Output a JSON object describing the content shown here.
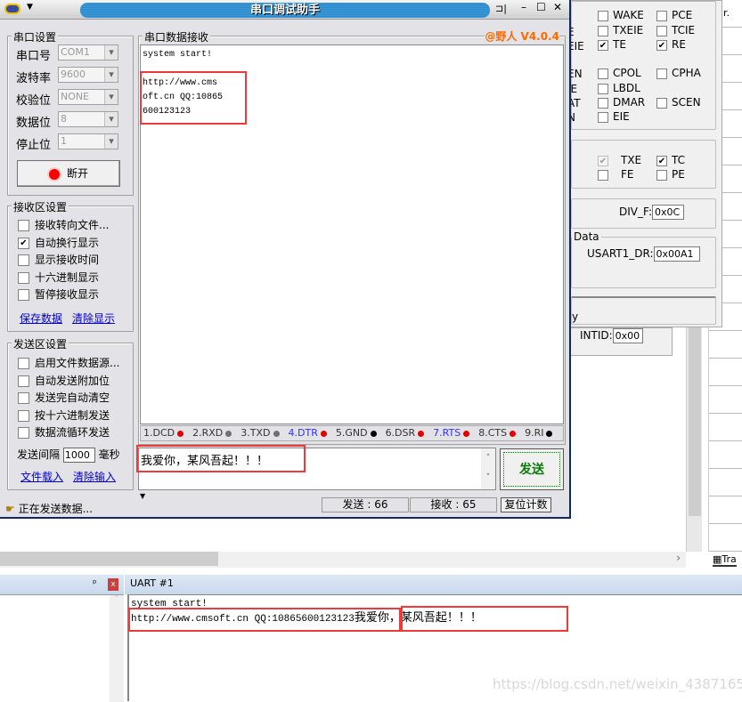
{
  "colors": {
    "title_blue": "#3a9ad9",
    "accent_orange": "#ff6a00",
    "send_green": "#0a7a0a",
    "highlight_red": "#f03a3a",
    "link_blue": "#0000cc"
  },
  "window": {
    "title": "串口调试助手",
    "version": "@野人 V4.0.4"
  },
  "port_settings": {
    "title": "串口设置",
    "fields": [
      {
        "label": "串口号",
        "value": "COM1"
      },
      {
        "label": "波特率",
        "value": "9600"
      },
      {
        "label": "校验位",
        "value": "NONE"
      },
      {
        "label": "数据位",
        "value": "8"
      },
      {
        "label": "停止位",
        "value": "1"
      }
    ],
    "open_button": "断开"
  },
  "recv_settings": {
    "title": "接收区设置",
    "options": [
      {
        "label": "接收转向文件...",
        "checked": false
      },
      {
        "label": "自动换行显示",
        "checked": true
      },
      {
        "label": "显示接收时间",
        "checked": false
      },
      {
        "label": "十六进制显示",
        "checked": false
      },
      {
        "label": "暂停接收显示",
        "checked": false
      }
    ],
    "save": "保存数据",
    "clear": "清除显示"
  },
  "send_settings": {
    "title": "发送区设置",
    "options": [
      {
        "label": "启用文件数据源...",
        "checked": false
      },
      {
        "label": "自动发送附加位",
        "checked": false
      },
      {
        "label": "发送完自动清空",
        "checked": false
      },
      {
        "label": "按十六进制发送",
        "checked": false
      },
      {
        "label": "数据流循环发送",
        "checked": false
      }
    ],
    "interval_label": "发送间隔",
    "interval_value": "1000",
    "interval_unit": "毫秒",
    "load": "文件载入",
    "clear": "清除输入"
  },
  "receive": {
    "title": "串口数据接收",
    "lines": [
      "system start!",
      "",
      "http://www.cms",
      "oft.cn QQ:10865",
      "600123123"
    ]
  },
  "pins": [
    {
      "label": "1.DCD",
      "color": "#e00000",
      "blue": false
    },
    {
      "label": "2.RXD",
      "color": "#707070",
      "blue": false
    },
    {
      "label": "3.TXD",
      "color": "#707070",
      "blue": false
    },
    {
      "label": "4.DTR",
      "color": "#e00000",
      "blue": true
    },
    {
      "label": "5.GND",
      "color": "#000000",
      "blue": false
    },
    {
      "label": "6.DSR",
      "color": "#e00000",
      "blue": false
    },
    {
      "label": "7.RTS",
      "color": "#e00000",
      "blue": true
    },
    {
      "label": "8.CTS",
      "color": "#e00000",
      "blue": false
    },
    {
      "label": "9.RI",
      "color": "#000000",
      "blue": false
    }
  ],
  "send": {
    "text": "我爱你，某风吾起！！！",
    "button": "发送"
  },
  "status": {
    "message": "正在发送数据...",
    "sent": "发送 : 66",
    "received": "接收 : 65",
    "reset": "复位计数"
  },
  "usart_panel": {
    "checks": [
      {
        "label": "WAKE",
        "checked": false
      },
      {
        "label": "PCE",
        "checked": false
      },
      {
        "label": "TXEIE",
        "checked": false
      },
      {
        "label": "TCIE",
        "checked": false
      },
      {
        "label": "TE",
        "checked": true
      },
      {
        "label": "RE",
        "checked": true
      },
      {
        "label": "CPOL",
        "checked": false
      },
      {
        "label": "CPHA",
        "checked": false
      },
      {
        "label": "LBDL",
        "checked": false
      },
      {
        "label": "DMAR",
        "checked": false
      },
      {
        "label": "SCEN",
        "checked": false
      },
      {
        "label": "EIE",
        "checked": false
      }
    ],
    "cut_labels": [
      "E",
      "EIE",
      "EN",
      "IE",
      "AT",
      "N"
    ],
    "status_checks": [
      {
        "label": "TXE",
        "checked": true
      },
      {
        "label": "TC",
        "checked": true
      },
      {
        "label": "FE",
        "checked": false
      },
      {
        "label": "PE",
        "checked": false
      }
    ],
    "div_f_label": "DIV_F:",
    "div_f": "0x0C",
    "data_group": "Data",
    "dr_label": "USART1_DR:",
    "dr": "0x00A1",
    "intid_label": "INTID:",
    "intid": "0x00",
    "cut_y": "y",
    "cut_r": "r."
  },
  "bottom": {
    "tab": "UART #1",
    "lines": [
      "system start!",
      "http://www.cmsoft.cn QQ:10865600123123"
    ],
    "received_text": "我爱你，某风吾起！！！",
    "tra": "Tra"
  },
  "watermark": "https://blog.csdn.net/weixin_43871650"
}
